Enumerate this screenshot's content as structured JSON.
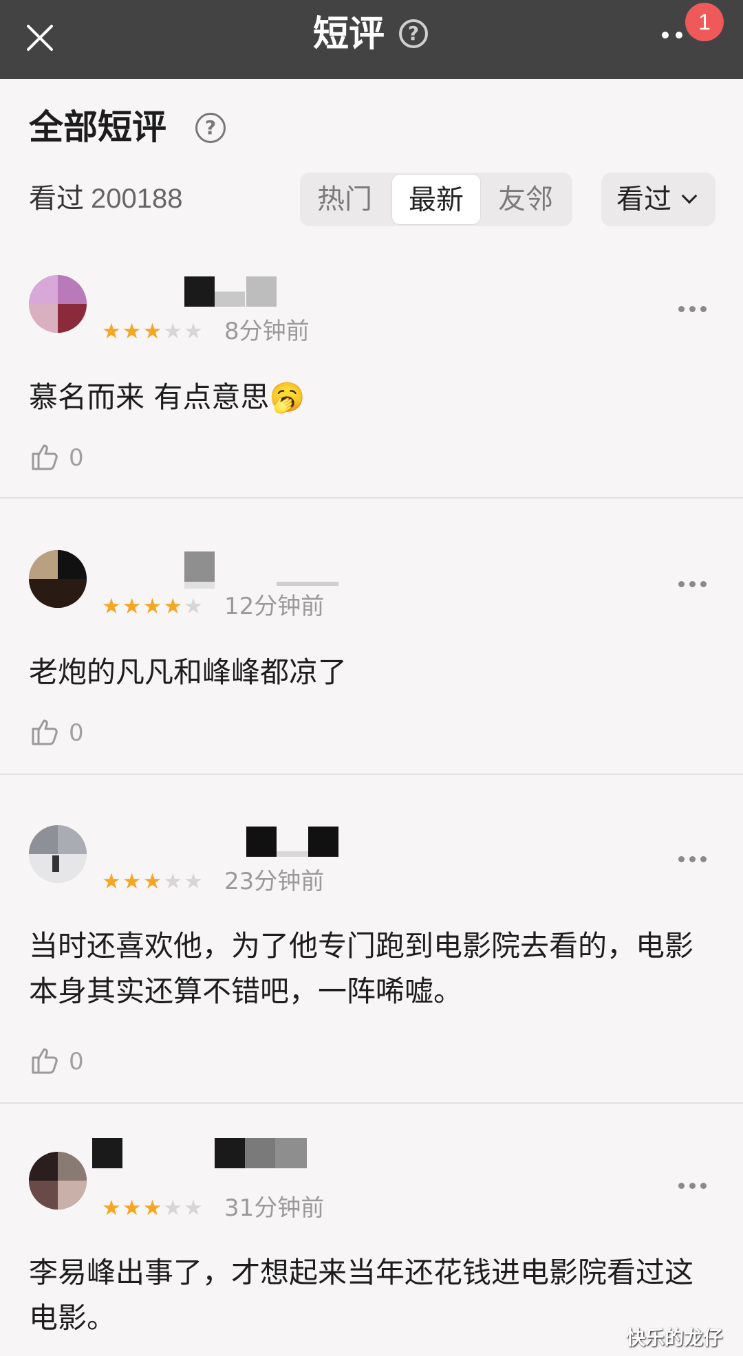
{
  "header": {
    "title": "短评",
    "help_glyph": "?",
    "notification_count": "1"
  },
  "section": {
    "title": "全部短评",
    "help_glyph": "?",
    "seen_label": "看过",
    "seen_count": "200188",
    "tabs": [
      "热门",
      "最新",
      "友邻"
    ],
    "active_tab": "最新",
    "filter_label": "看过"
  },
  "comments": [
    {
      "rating": 3,
      "stars": "★★★",
      "stars_off": "★★",
      "time": "8分钟前",
      "text": "慕名而来 有点意思",
      "emoji": "🥱",
      "likes": "0"
    },
    {
      "rating": 4,
      "stars": "★★★★",
      "stars_off": "★",
      "time": "12分钟前",
      "text": "老炮的凡凡和峰峰都凉了",
      "likes": "0"
    },
    {
      "rating": 3,
      "stars": "★★★",
      "stars_off": "★★",
      "time": "23分钟前",
      "text": "当时还喜欢他，为了他专门跑到电影院去看的，电影本身其实还算不错吧，一阵唏嘘。",
      "likes": "0"
    },
    {
      "rating": 3,
      "stars": "★★★",
      "stars_off": "★★",
      "time": "31分钟前",
      "text": "李易峰出事了，才想起来当年还花钱进电影院看过这电影。"
    }
  ],
  "watermark": "快乐的龙仔",
  "colors": {
    "topbar": "#444343",
    "star": "#f5a623",
    "badge": "#f0595a"
  }
}
